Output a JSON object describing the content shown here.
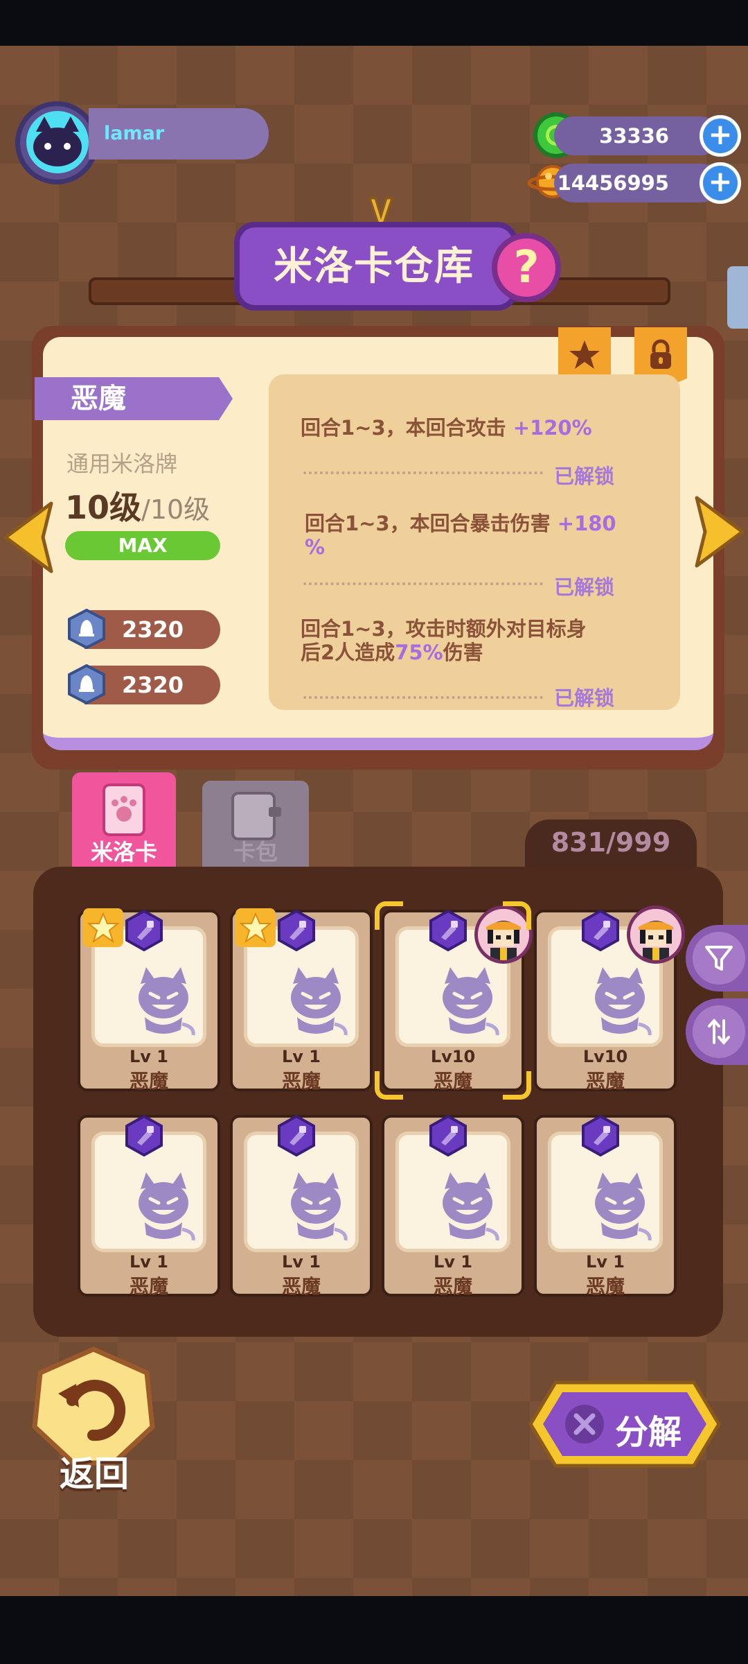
{
  "player": {
    "name": "lamar"
  },
  "currencies": [
    {
      "icon": "green-donut-coin-icon",
      "amount": "33336"
    },
    {
      "icon": "gold-planet-coin-icon",
      "amount": "14456995"
    }
  ],
  "title": "米洛卡仓库",
  "help_label": "?",
  "detail": {
    "name": "恶魔",
    "type": "通用米洛牌",
    "level_current": "10级",
    "level_max": "/10级",
    "max_badge": "MAX",
    "stats": [
      {
        "icon": "bell-icon",
        "value": "2320"
      },
      {
        "icon": "bell-icon",
        "value": "2320"
      }
    ],
    "skills": [
      {
        "text": "回合1~3，本回合攻击 ",
        "highlight": "+120%",
        "status": "已解锁"
      },
      {
        "text": "回合1~3，本回合暴击伤害 ",
        "highlight": "+180",
        "text_after": "%",
        "status": "已解锁"
      },
      {
        "text_line1": "回合1~3，攻击时额外对目标身",
        "text_line2_pre": "后2人造成",
        "highlight": "75%",
        "text_line2_post": "伤害",
        "status": "已解锁"
      }
    ]
  },
  "tabs": [
    {
      "label": "米洛卡",
      "active": true
    },
    {
      "label": "卡包",
      "active": false
    }
  ],
  "inventory_count": "831/999",
  "cards": [
    {
      "level": "Lv 1",
      "name": "恶魔",
      "star": true,
      "selected": false,
      "character": false
    },
    {
      "level": "Lv 1",
      "name": "恶魔",
      "star": true,
      "selected": false,
      "character": false
    },
    {
      "level": "Lv10",
      "name": "恶魔",
      "star": false,
      "selected": true,
      "character": true
    },
    {
      "level": "Lv10",
      "name": "恶魔",
      "star": false,
      "selected": false,
      "character": true
    },
    {
      "level": "Lv 1",
      "name": "恶魔",
      "star": false,
      "selected": false,
      "character": false
    },
    {
      "level": "Lv 1",
      "name": "恶魔",
      "star": false,
      "selected": false,
      "character": false
    },
    {
      "level": "Lv 1",
      "name": "恶魔",
      "star": false,
      "selected": false,
      "character": false
    },
    {
      "level": "Lv 1",
      "name": "恶魔",
      "star": false,
      "selected": false,
      "character": false
    }
  ],
  "side_buttons": [
    "filter-icon",
    "sort-icon"
  ],
  "back_label": "返回",
  "decompose_label": "分解",
  "colors": {
    "accent_purple": "#8a4fc4",
    "max_green": "#6bc835",
    "unlock_purple": "#a679d8",
    "card_bg": "#d3b190"
  }
}
